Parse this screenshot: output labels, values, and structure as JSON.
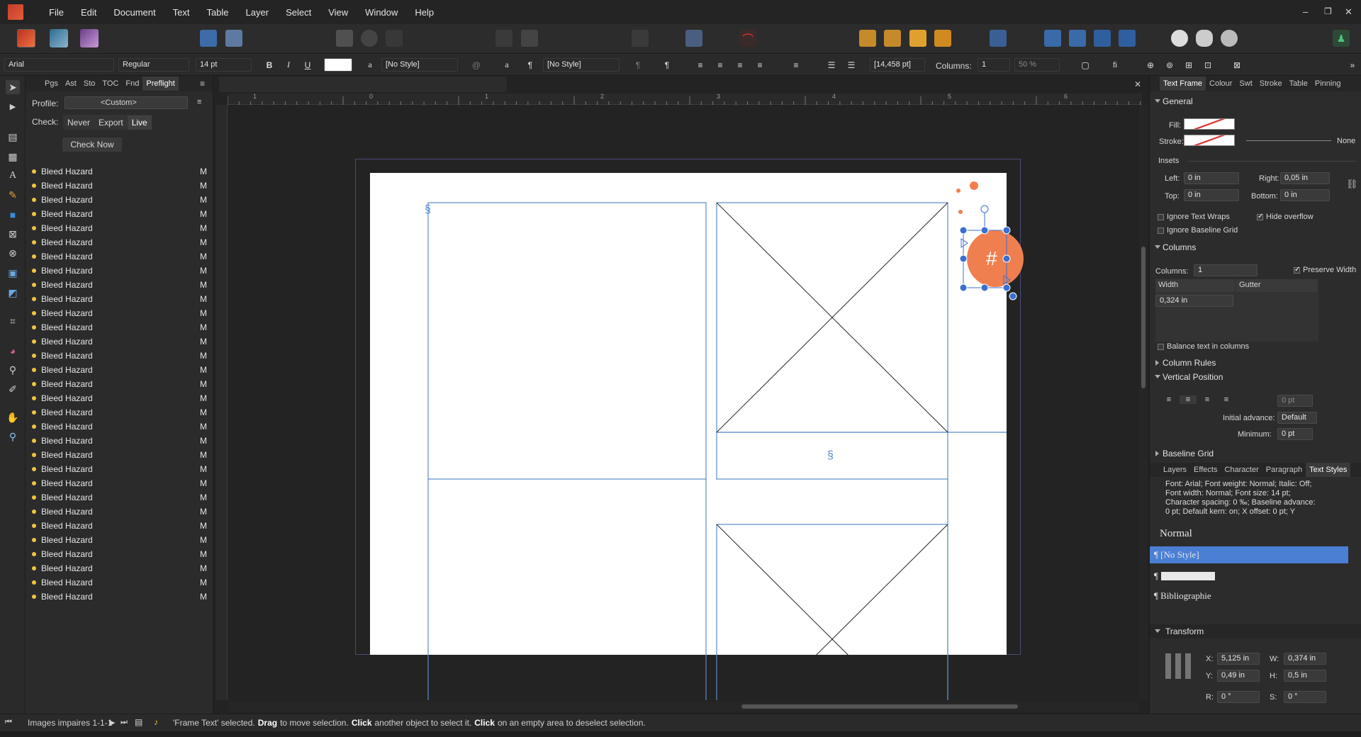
{
  "menu": [
    "File",
    "Edit",
    "Document",
    "Text",
    "Table",
    "Layer",
    "Select",
    "View",
    "Window",
    "Help"
  ],
  "window_controls": {
    "minimize": "–",
    "restore": "❐",
    "close": "✕"
  },
  "context_toolbar": {
    "font_family": "Arial",
    "font_style": "Regular",
    "font_size": "14 pt",
    "bold": "B",
    "italic": "I",
    "underline": "U",
    "char_style_glyph": "a",
    "char_style": "[No Style]",
    "para_style_glyph": "¶",
    "para_style": "[No Style]",
    "baseline_value": "[14,458 pt]",
    "columns_label": "Columns:",
    "columns_value": "1",
    "opacity_value": "50 %"
  },
  "left_panel": {
    "tabs": [
      "Pgs",
      "Ast",
      "Sto",
      "TOC",
      "Fnd",
      "Preflight"
    ],
    "active_tab": "Preflight",
    "profile_label": "Profile:",
    "profile_value": "<Custom>",
    "check_label": "Check:",
    "check_options": [
      "Never",
      "Export",
      "Live"
    ],
    "check_now": "Check Now",
    "issues": [
      {
        "label": "Bleed Hazard",
        "flag": "M"
      },
      {
        "label": "Bleed Hazard",
        "flag": "M"
      },
      {
        "label": "Bleed Hazard",
        "flag": "M"
      },
      {
        "label": "Bleed Hazard",
        "flag": "M"
      },
      {
        "label": "Bleed Hazard",
        "flag": "M"
      },
      {
        "label": "Bleed Hazard",
        "flag": "M"
      },
      {
        "label": "Bleed Hazard",
        "flag": "M"
      },
      {
        "label": "Bleed Hazard",
        "flag": "M"
      },
      {
        "label": "Bleed Hazard",
        "flag": "M"
      },
      {
        "label": "Bleed Hazard",
        "flag": "M"
      },
      {
        "label": "Bleed Hazard",
        "flag": "M"
      },
      {
        "label": "Bleed Hazard",
        "flag": "M"
      },
      {
        "label": "Bleed Hazard",
        "flag": "M"
      },
      {
        "label": "Bleed Hazard",
        "flag": "M"
      },
      {
        "label": "Bleed Hazard",
        "flag": "M"
      },
      {
        "label": "Bleed Hazard",
        "flag": "M"
      },
      {
        "label": "Bleed Hazard",
        "flag": "M"
      },
      {
        "label": "Bleed Hazard",
        "flag": "M"
      },
      {
        "label": "Bleed Hazard",
        "flag": "M"
      },
      {
        "label": "Bleed Hazard",
        "flag": "M"
      },
      {
        "label": "Bleed Hazard",
        "flag": "M"
      },
      {
        "label": "Bleed Hazard",
        "flag": "M"
      },
      {
        "label": "Bleed Hazard",
        "flag": "M"
      },
      {
        "label": "Bleed Hazard",
        "flag": "M"
      },
      {
        "label": "Bleed Hazard",
        "flag": "M"
      },
      {
        "label": "Bleed Hazard",
        "flag": "M"
      },
      {
        "label": "Bleed Hazard",
        "flag": "M"
      },
      {
        "label": "Bleed Hazard",
        "flag": "M"
      },
      {
        "label": "Bleed Hazard",
        "flag": "M"
      },
      {
        "label": "Bleed Hazard",
        "flag": "M"
      },
      {
        "label": "Bleed Hazard",
        "flag": "M"
      }
    ]
  },
  "ruler": {
    "labels": [
      "1",
      "0",
      "1",
      "2",
      "3",
      "4",
      "5",
      "6"
    ]
  },
  "canvas": {
    "section_mark": "§",
    "hash_mark": "#"
  },
  "right_panel": {
    "tabs": [
      "Text Frame",
      "Colour",
      "Swt",
      "Stroke",
      "Table",
      "Pinning"
    ],
    "active_tab": "Text Frame",
    "general": "General",
    "fill_label": "Fill:",
    "stroke_label": "Stroke:",
    "stroke_none": "None",
    "insets": "Insets",
    "left_label": "Left:",
    "left_value": "0 in",
    "right_label": "Right:",
    "right_value": "0,05 in",
    "top_label": "Top:",
    "top_value": "0 in",
    "bottom_label": "Bottom:",
    "bottom_value": "0 in",
    "ignore_wraps": "Ignore Text Wraps",
    "hide_overflow": "Hide overflow",
    "ignore_baseline": "Ignore Baseline Grid",
    "columns_section": "Columns",
    "columns_label": "Columns:",
    "columns_value": "1",
    "preserve_width": "Preserve Width",
    "width_label": "Width",
    "gutter_label": "Gutter",
    "width_value": "0,324 in",
    "balance": "Balance text in columns",
    "column_rules": "Column Rules",
    "vertical_position": "Vertical Position",
    "vp_value": "0 pt",
    "initial_advance_label": "Initial advance:",
    "initial_advance_value": "Default",
    "minimum_label": "Minimum:",
    "minimum_value": "0 pt",
    "baseline_grid": "Baseline Grid",
    "lower_tabs": [
      "Layers",
      "Effects",
      "Character",
      "Paragraph",
      "Text Styles"
    ],
    "lower_active": "Text Styles",
    "style_desc_1": "Font: Arial; Font weight: Normal; Italic: Off;",
    "style_desc_2": "Font width: Normal; Font size: 14 pt;",
    "style_desc_3": "Character spacing: 0 ‰; Baseline advance:",
    "style_desc_4": "0 pt; Default kern: on; X offset: 0 pt; Y",
    "style_normal": "Normal",
    "style_nostyle": "¶ [No Style]",
    "style_blank_glyph": "¶",
    "style_biblio": "¶ Bibliographie",
    "transform": "Transform",
    "x_label": "X:",
    "x_value": "5,125 in",
    "w_label": "W:",
    "w_value": "0,374 in",
    "y_label": "Y:",
    "y_value": "0,49 in",
    "h_label": "H:",
    "h_value": "0,5 in",
    "r_label": "R:",
    "r_value": "0 °",
    "s_label": "S:",
    "s_value": "0 °"
  },
  "status": {
    "page": "Images impaires 1-1-1",
    "message_1": "'Frame Text' selected.",
    "message_2": "Drag",
    "message_3": "to move selection.",
    "message_4": "Click",
    "message_5": "another object to select it.",
    "message_6": "Click",
    "message_7": "on an empty area to deselect selection."
  },
  "colors": {
    "accent": "#4a7fd4",
    "orange": "#f07f4f",
    "frame_blue": "#5b8bc8",
    "page": "#ffffff",
    "canvas": "#232323"
  }
}
